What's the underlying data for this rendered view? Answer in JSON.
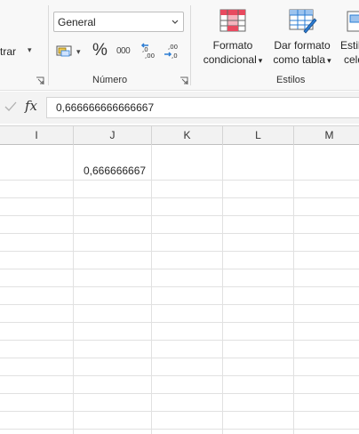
{
  "ribbon": {
    "filter_partial_label": "trar",
    "number_format": {
      "selected": "General"
    },
    "groups": {
      "number": "Número",
      "styles": "Estilos"
    },
    "buttons": {
      "conditional_format": [
        "Formato",
        "condicional"
      ],
      "format_as_table": [
        "Dar formato",
        "como tabla"
      ],
      "cell_styles": [
        "Estil",
        "celd"
      ]
    },
    "thousands_label": "000",
    "percent_label": "%"
  },
  "formula_bar": {
    "fx_label": "fx",
    "value": "0,666666666666667"
  },
  "columns": [
    "I",
    "J",
    "K",
    "L",
    "M"
  ],
  "cells": {
    "J1": "0,666666667"
  },
  "colors": {
    "accent": "#217346",
    "conditional_red": "#e84a5f",
    "table_blue": "#2b7cd3"
  }
}
